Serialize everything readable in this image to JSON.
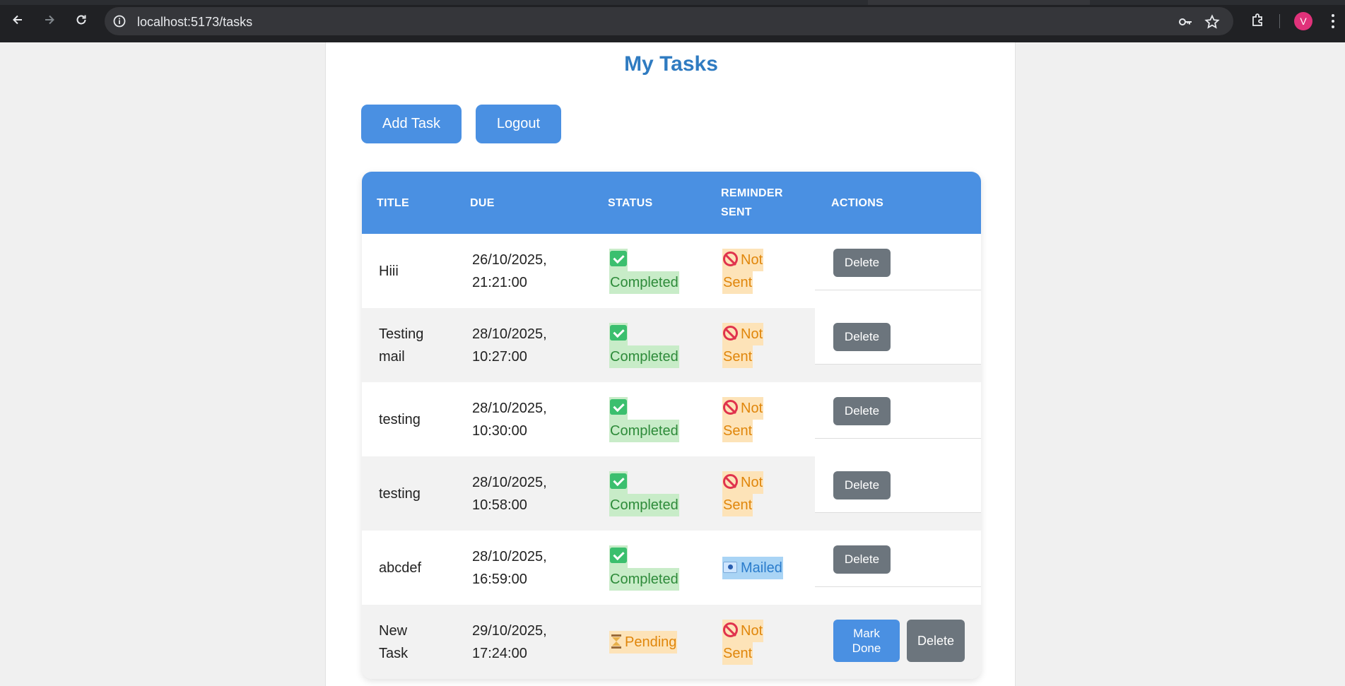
{
  "browser": {
    "url": "localhost:5173/tasks",
    "profile_initial": "V",
    "icons": [
      "back-icon",
      "forward-icon",
      "reload-icon",
      "site-info-icon",
      "key-icon",
      "star-icon",
      "extensions-icon",
      "more-icon"
    ]
  },
  "page": {
    "title": "My Tasks",
    "add_task_label": "Add Task",
    "logout_label": "Logout"
  },
  "table": {
    "headers": {
      "title": "TITLE",
      "due": "DUE",
      "status": "STATUS",
      "reminder_line1": "REMINDER",
      "reminder_line2": "SENT",
      "actions": "ACTIONS"
    },
    "rows": [
      {
        "title": "Hiii",
        "due_date": "26/10/2025,",
        "due_time": "21:21:00",
        "status": "Completed",
        "reminder": "Sent",
        "reminder_prefix": "Not",
        "delete_label": "Delete"
      },
      {
        "title_l1": "Testing",
        "title_l2": "mail",
        "due_date": "28/10/2025,",
        "due_time": "10:27:00",
        "status": "Completed",
        "reminder": "Sent",
        "reminder_prefix": "Not",
        "delete_label": "Delete"
      },
      {
        "title": "testing",
        "due_date": "28/10/2025,",
        "due_time": "10:30:00",
        "status": "Completed",
        "reminder": "Sent",
        "reminder_prefix": "Not",
        "delete_label": "Delete"
      },
      {
        "title": "testing",
        "due_date": "28/10/2025,",
        "due_time": "10:58:00",
        "status": "Completed",
        "reminder": "Sent",
        "reminder_prefix": "Not",
        "delete_label": "Delete"
      },
      {
        "title": "abcdef",
        "due_date": "28/10/2025,",
        "due_time": "16:59:00",
        "status": "Completed",
        "reminder": "Mailed",
        "delete_label": "Delete"
      },
      {
        "title_l1": "New",
        "title_l2": "Task",
        "due_date": "29/10/2025,",
        "due_time": "17:24:00",
        "status": "Pending",
        "reminder": "Sent",
        "reminder_prefix": "Not",
        "mark_l1": "Mark",
        "mark_l2": "Done",
        "delete_label": "Delete"
      }
    ]
  },
  "colors": {
    "accent": "#4a90e2",
    "title": "#2f7bc1",
    "completed": "#2e8b3a",
    "pending": "#e0860b",
    "mailed": "#2a7ccc",
    "delete": "#6c757d"
  }
}
